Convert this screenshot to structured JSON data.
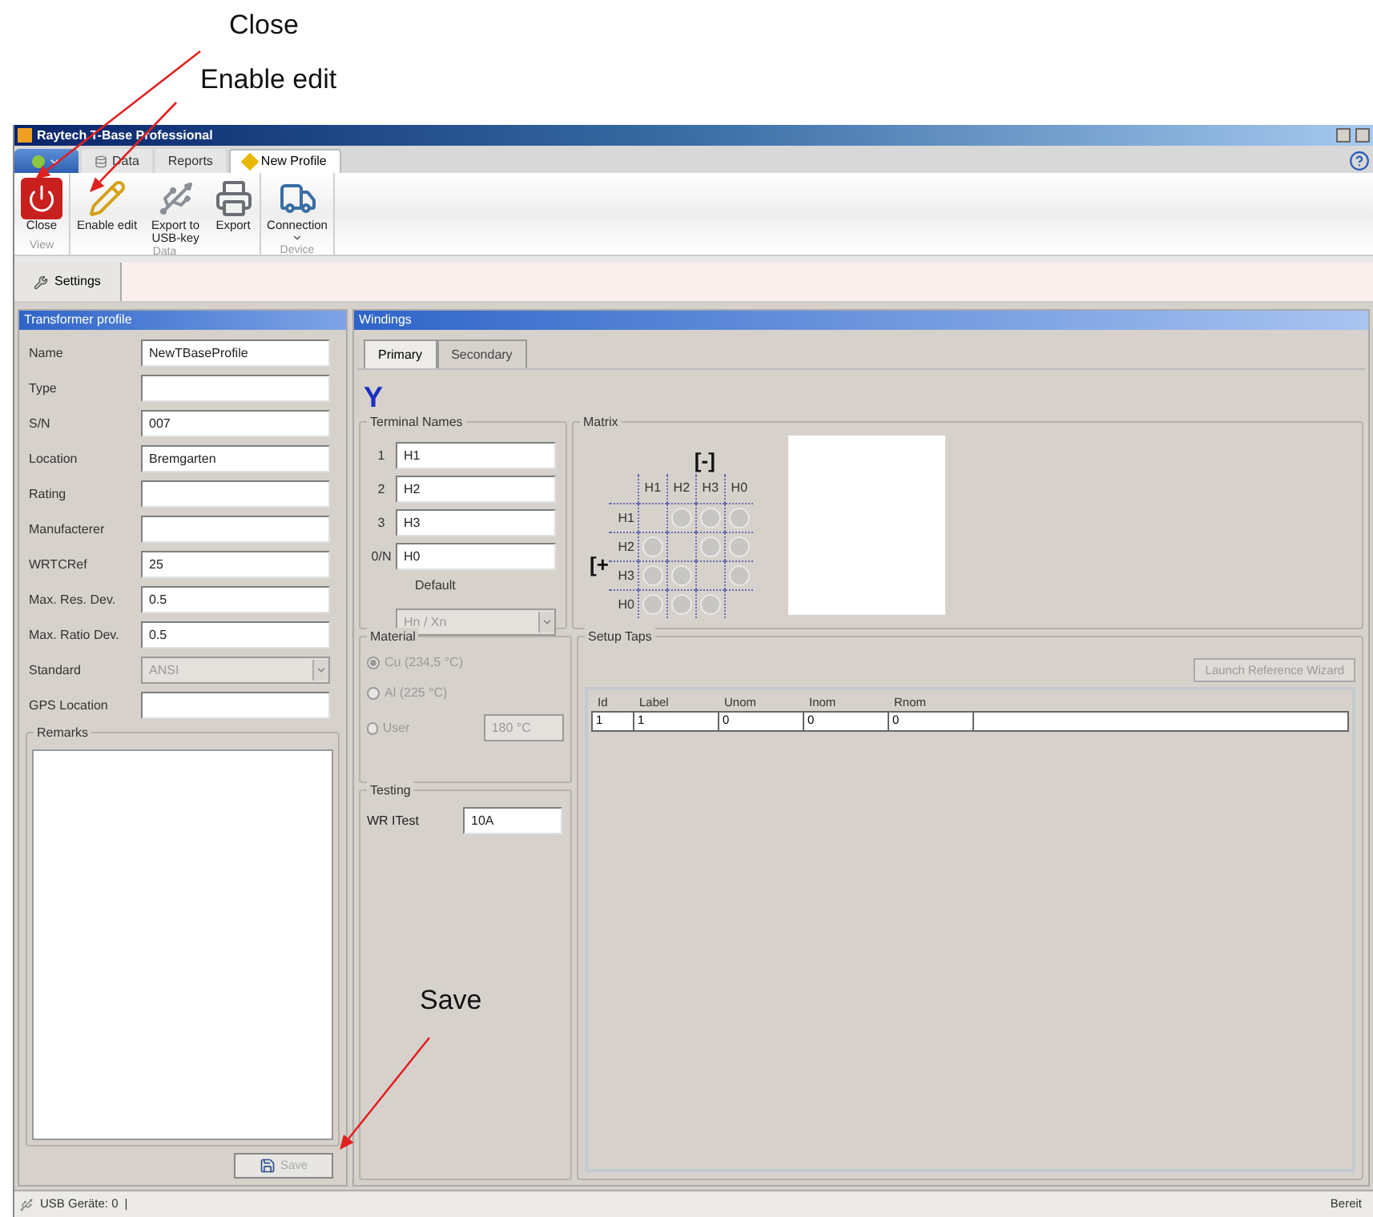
{
  "annotations": [
    {
      "text": "Close"
    },
    {
      "text": "Enable edit"
    },
    {
      "text": "Save"
    }
  ],
  "window": {
    "title": "Raytech T-Base Professional"
  },
  "ribbon": {
    "tabs": [
      {
        "label": "Data",
        "selected": false
      },
      {
        "label": "Reports",
        "selected": false
      },
      {
        "label": "New Profile",
        "selected": true
      }
    ],
    "groups": [
      {
        "label": "View",
        "buttons": [
          "Close"
        ]
      },
      {
        "label": "Data",
        "buttons": [
          "Enable edit",
          "Export to USB-key",
          "Export"
        ]
      },
      {
        "label": "Device",
        "buttons": [
          "Connection"
        ]
      }
    ]
  },
  "doc_tabs": [
    {
      "label": "Settings",
      "selected": true
    }
  ],
  "transformer_profile": {
    "title": "Transformer profile",
    "fields": [
      {
        "label": "Name",
        "value": "NewTBaseProfile",
        "kind": "text"
      },
      {
        "label": "Type",
        "kind": "text"
      },
      {
        "label": "S/N",
        "value": "007",
        "kind": "text"
      },
      {
        "label": "Location",
        "value": "Bremgarten",
        "kind": "text"
      },
      {
        "label": "Rating",
        "kind": "text"
      },
      {
        "label": "Manufacterer",
        "kind": "text"
      },
      {
        "label": "WRTCRef",
        "value": "25",
        "kind": "text"
      },
      {
        "label": "Max. Res. Dev.",
        "value": "0.5",
        "kind": "text"
      },
      {
        "label": "Max. Ratio Dev.",
        "value": "0.5",
        "kind": "text"
      },
      {
        "label": "Standard",
        "value": "ANSI",
        "kind": "select"
      },
      {
        "label": "GPS Location",
        "kind": "text"
      }
    ],
    "remarks_label": "Remarks",
    "save_button": "Save"
  },
  "windings": {
    "title": "Windings",
    "tabs": [
      {
        "label": "Primary",
        "selected": true
      },
      {
        "label": "Secondary",
        "selected": false
      }
    ],
    "symbol": "Y",
    "terminal_names": {
      "title": "Terminal Names",
      "rows": [
        {
          "label": "1",
          "value": "H1"
        },
        {
          "label": "2",
          "value": "H2"
        },
        {
          "label": "3",
          "value": "H3"
        },
        {
          "label": "0/N",
          "value": "H0"
        }
      ],
      "default_label": "Default",
      "default_value": "Hn / Xn"
    },
    "matrix": {
      "title": "Matrix",
      "minus_label": "[-]",
      "plus_label": "[+",
      "columns": [
        "H1",
        "H2",
        "H3",
        "H0"
      ],
      "rows": [
        "H1",
        "H2",
        "H3",
        "H0"
      ]
    },
    "material": {
      "title": "Material",
      "options": [
        {
          "label": "Cu (234,5 °C)",
          "selected": true
        },
        {
          "label": "Al (225 °C)",
          "selected": false
        },
        {
          "label": "User",
          "selected": false
        }
      ],
      "user_value": "180 °C"
    },
    "testing": {
      "title": "Testing",
      "label": "WR ITest",
      "value": "10A"
    },
    "setup_taps": {
      "title": "Setup Taps",
      "button": "Launch Reference Wizard",
      "columns": [
        "Id",
        "Label",
        "Unom",
        "Inom",
        "Rnom"
      ],
      "rows": [
        [
          "1",
          "1",
          "0",
          "0",
          "0"
        ]
      ]
    }
  },
  "status_bar": {
    "usb": "USB Geräte: 0",
    "separator": "|",
    "state": "Bereit"
  }
}
